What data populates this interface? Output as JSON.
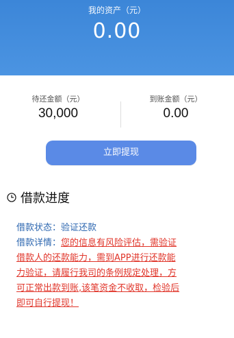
{
  "assets": {
    "label": "我的资产（元）",
    "value": "0.00"
  },
  "stats": {
    "pending_label": "待还金额（元）",
    "pending_value": "30,000",
    "received_label": "到账金额（元）",
    "received_value": "0.00"
  },
  "actions": {
    "withdraw_label": "立即提现"
  },
  "progress": {
    "title": "借款进度"
  },
  "loan": {
    "status_label": "借款状态：",
    "status_value": "验证还款",
    "detail_label": "借款详情：",
    "detail_lines": [
      "您的信息有风险评估，需验证",
      "借款人的还款能力，需到APP进行还款能",
      "力验证，请履行我司的条例规定处理，方",
      "可正常出款到账,该笔资金不收取，检验后",
      "即可自行提现！"
    ]
  },
  "icons": {
    "progress": "clock-icon"
  },
  "colors": {
    "primary": "#4a90e2",
    "button": "#5a8ae6",
    "link": "#2d67b0",
    "alert": "#e0352a"
  }
}
